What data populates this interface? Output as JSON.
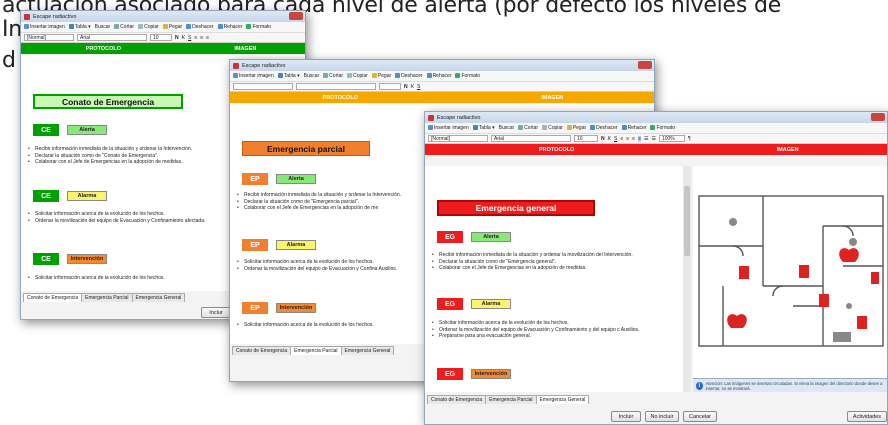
{
  "background_text": {
    "line1": "actuación asociado para cada nivel de alerta (por defecto los niveles de",
    "line2": "In",
    "line3": "d"
  },
  "colors": {
    "green": "#00a000",
    "orange": "#f5a800",
    "red": "#ee1c1c",
    "alerta": "#88e878",
    "alarma": "#fbf46a",
    "intervencion": "#f7882c"
  },
  "windows": [
    {
      "title": "Escape radiactivo",
      "toolbar": [
        "Insertar imagen",
        "Tabla ▾",
        "Buscar",
        "Cortar",
        "Copiar",
        "Pegar",
        "Deshacer",
        "Rehacer",
        "Formato"
      ],
      "style_select": "[Normal]",
      "font_select": "Arial",
      "size_select": "10",
      "headers": [
        "PROTOCOLO",
        "IMAGEN"
      ],
      "main_title": "Conato de Emergencia",
      "code": "CE",
      "levels": [
        {
          "name": "Alerta",
          "bullets": [
            "Recibir información inmediata de la situación y ordenar la Intervención.",
            "Declarar la situación como de \"Conato de Emergencia\".",
            "Colaborar con el Jefe de Emergencias en la adopción de medidas."
          ]
        },
        {
          "name": "Alarma",
          "bullets": [
            "Solicitar información acerca de la evolución de los hechos.",
            "Ordenar la movilización del equipo de Evacuación y Confinamiento afectada."
          ]
        },
        {
          "name": "Intervención",
          "bullets": [
            "Solicitar información acerca de la evolución de los hechos."
          ]
        }
      ],
      "tabs": [
        "Conato de Emergencia",
        "Emergencia Parcial",
        "Emergencia General"
      ],
      "button": "Inclur"
    },
    {
      "title": "Escape radiactivo",
      "toolbar": [
        "Insertar imagen",
        "Tabla ▾",
        "Buscar",
        "Cortar",
        "Copiar",
        "Pegar",
        "Deshacer",
        "Rehacer",
        "Formato"
      ],
      "headers": [
        "PROTOCOLO",
        "IMAGEN"
      ],
      "main_title": "Emergencia parcial",
      "code": "EP",
      "levels": [
        {
          "name": "Alerta",
          "bullets": [
            "Recibir información inmediata de la situación y ordenar la Intervención.",
            "Declarar la situación como de \"Emergencia parcial\".",
            "Colaborar con el Jefe de Emergencias en la adopción de me"
          ]
        },
        {
          "name": "Alarma",
          "bullets": [
            "Solicitar información acerca de la evolución de los hechos.",
            "Ordenar la movilización del equipo de Evacuación y Confina Auxilios."
          ]
        },
        {
          "name": "Intervención",
          "bullets": [
            "Solicitar información acerca de la evolución de los hechos."
          ]
        }
      ],
      "tabs": [
        "Conato de Emergencia",
        "Emergencia Parcial",
        "Emergencia General"
      ]
    },
    {
      "title": "Escape radiactivo",
      "toolbar": [
        "Insertar imagen",
        "Tabla ▾",
        "Buscar",
        "Cortar",
        "Copiar",
        "Pegar",
        "Deshacer",
        "Rehacer",
        "Formato"
      ],
      "style_select": "[Normal]",
      "font_select": "Arial",
      "size_select": "10",
      "zoom_select": "100%",
      "headers": [
        "PROTOCOLO",
        "IMAGEN"
      ],
      "main_title": "Emergencia general",
      "code": "EG",
      "levels": [
        {
          "name": "Alerta",
          "bullets": [
            "Recibir información inmediata de la situación y ordenar la movilización del Intervención.",
            "Declarar la situación como de \"Emergencia general\".",
            "Colaborar con el Jefe de Emergencias en la adopción de medidas."
          ]
        },
        {
          "name": "Alarma",
          "bullets": [
            "Solicitar información acerca de la evolución de los hechos.",
            "Ordenar la movilización del equipo de Evacuación y Confinamiento y del equipo c Auxilios.",
            "Prepararse para una evacuación general."
          ]
        },
        {
          "name": "Intervención",
          "bullets": []
        }
      ],
      "info_note": "Atención: Las imágenes se insertan circuladas. Si eleva la imagen del directorio donde desee a insertar, no se mostrará.",
      "tabs": [
        "Conato de Emergencia",
        "Emergencia Parcial",
        "Emergencia General"
      ],
      "buttons": [
        "Incluir",
        "No incluir",
        "Cancelar",
        "Actividades"
      ]
    }
  ]
}
